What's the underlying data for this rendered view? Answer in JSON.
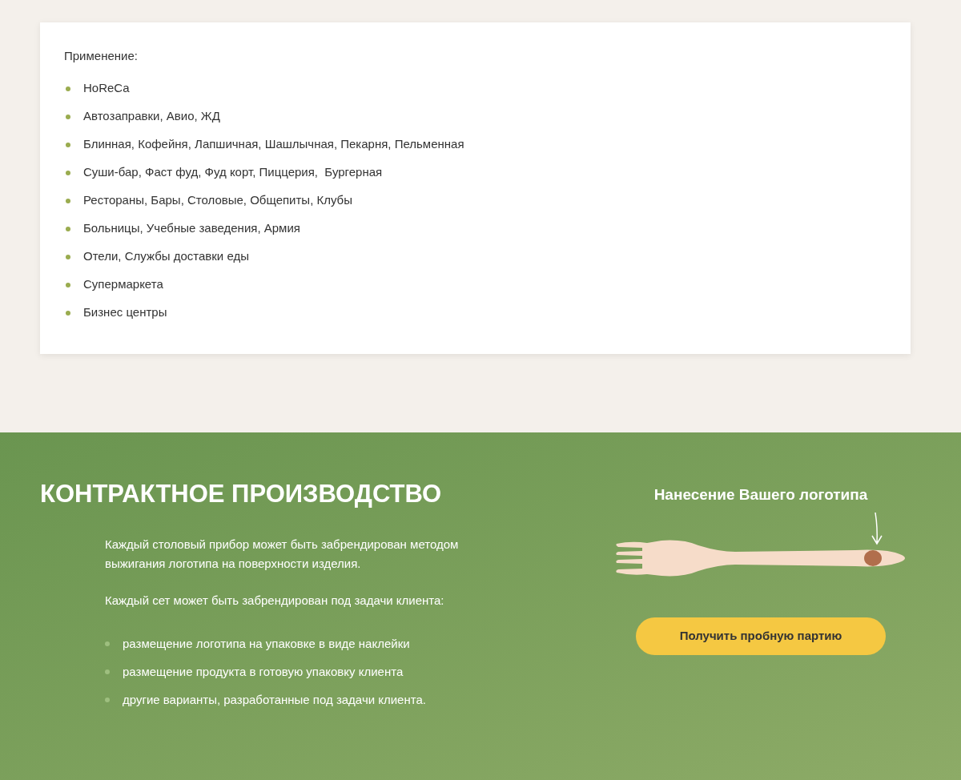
{
  "usage": {
    "title": "Применение:",
    "items": [
      "HoReCa",
      "Автозаправки, Авио, ЖД",
      "Блинная, Кофейня, Лапшичная, Шашлычная, Пекарня, Пельменная",
      "Суши-бар, Фаст фуд, Фуд корт, Пиццерия,  Бургерная",
      "Рестораны, Бары, Столовые, Общепиты, Клубы",
      "Больницы, Учебные заведения, Армия",
      "Отели, Службы доставки еды",
      "Супермаркета",
      "Бизнес центры"
    ]
  },
  "contract": {
    "title": "КОНТРАКТНОЕ ПРОИЗВОДСТВО",
    "paragraphs": [
      "Каждый столовый прибор может быть забрендирован методом выжигания логотипа на поверхности изделия.",
      "Каждый сет может быть забрендирован под задачи клиента:"
    ],
    "items": [
      "размещение логотипа на упаковке в виде наклейки",
      "размещение продукта в готовую упаковку клиента",
      "другие варианты, разработанные под задачи клиента."
    ],
    "logo_caption": "Нанесение Вашего логотипа",
    "button": "Получить пробную партию"
  }
}
